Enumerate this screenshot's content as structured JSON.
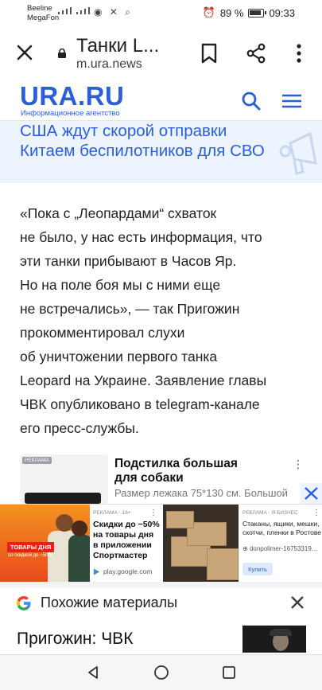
{
  "status_bar": {
    "carrier_line1": "Beeline",
    "carrier_line2": "MegaFon",
    "battery_percent": "89 %",
    "time": "09:33"
  },
  "browser": {
    "page_title": "Танки L...",
    "url": "m.ura.news"
  },
  "site": {
    "logo": "URA.RU",
    "logo_subtitle": "Информационное агентство",
    "brand_color": "#2b5fd9"
  },
  "banner": {
    "line1": "США ждут скорой отправки",
    "line2": "Китаем беспилотников для СВО"
  },
  "article": {
    "lines": [
      "«Пока с „Леопардами“ схваток",
      "не было, у нас есть информация, что",
      "эти танки прибывают в Часов Яр.",
      "Но на поле боя мы с ними еще",
      "не встречались», — так Пригожин",
      "прокомментировал слухи",
      "об уничтожении первого танка",
      "Leopard на Украине. Заявление главы",
      "ЧВК опубликовано в telegram-канале",
      "его пресс-службы."
    ]
  },
  "ad_card": {
    "badge": "РЕКЛАМА",
    "title_line1": "Подстилка большая",
    "title_line2": "для собаки",
    "description": "Размер лежака 75*130 см. Большой"
  },
  "ad_strip": {
    "ad1": {
      "image_tag": "ТОВАРЫ ДНЯ",
      "image_sub": "со скидкой до −50%",
      "meta": "РЕКЛАМА · 16+",
      "text": "Скидки до −50% на товары дня в приложении Спортмастер",
      "source": "play.google.com"
    },
    "ad2": {
      "meta": "РЕКЛАМА · Я БИЗНЕС",
      "text": "Стаканы, ящики, мешки, скотчи, пленки в Ростове",
      "source": "donpolimer-16753319...",
      "button": "Купить"
    }
  },
  "similar": {
    "header": "Похожие материалы",
    "first_item": "Пригожин: ЧВК"
  }
}
